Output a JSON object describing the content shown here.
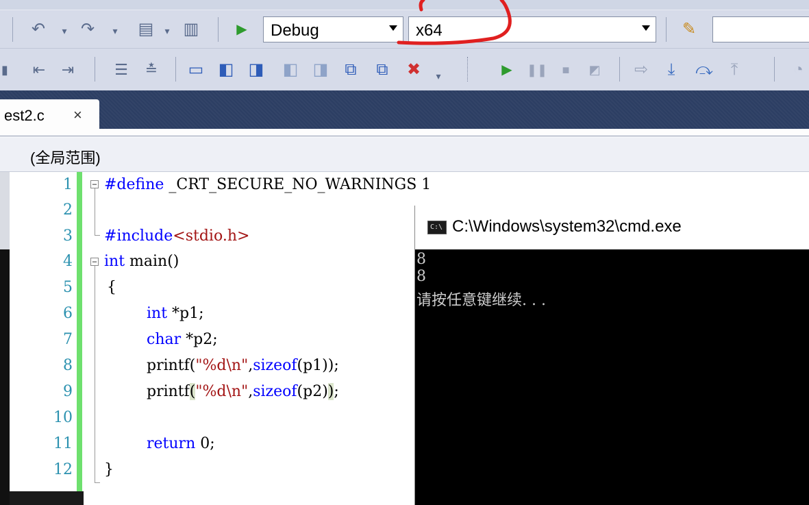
{
  "toolbar": {
    "config_value": "Debug",
    "platform_value": "x64",
    "search_value": ""
  },
  "tab": {
    "label": "est2.c",
    "close": "×"
  },
  "scope": {
    "label": "(全局范围)"
  },
  "editor": {
    "line_numbers": [
      "1",
      "2",
      "3",
      "4",
      "5",
      "6",
      "7",
      "8",
      "9",
      "10",
      "11",
      "12"
    ],
    "lines": {
      "l1_pp": "#define",
      "l1_rest": " _CRT_SECURE_NO_WARNINGS 1",
      "l3_pp": "#include",
      "l3_inc": "<stdio.h>",
      "l4_kw": "int",
      "l4_rest": " main()",
      "l5": "{",
      "l6_kw": "int",
      "l6_rest": " *p1;",
      "l7_kw": "char",
      "l7_rest": " *p2;",
      "l8_a": "printf(",
      "l8_str": "\"%d\\n\"",
      "l8_b": ",",
      "l8_kw": "sizeof",
      "l8_c": "(p1));",
      "l9_a": "printf",
      "l9_p": "(",
      "l9_str": "\"%d\\n\"",
      "l9_b": ",",
      "l9_kw": "sizeof",
      "l9_c": "(p2)",
      "l9_p2": ")",
      "l9_d": ";",
      "l11_kw": "return",
      "l11_rest": " 0;",
      "l12": "}"
    }
  },
  "console": {
    "icon_text": "C:\\",
    "title": "C:\\Windows\\system32\\cmd.exe",
    "output": [
      "8",
      "8",
      "请按任意键继续. . ."
    ]
  },
  "colors": {
    "keyword": "#0000ff",
    "string": "#a31515",
    "line_number": "#2b91af",
    "change_bar": "#6ee06e",
    "annotation": "#e02020"
  }
}
